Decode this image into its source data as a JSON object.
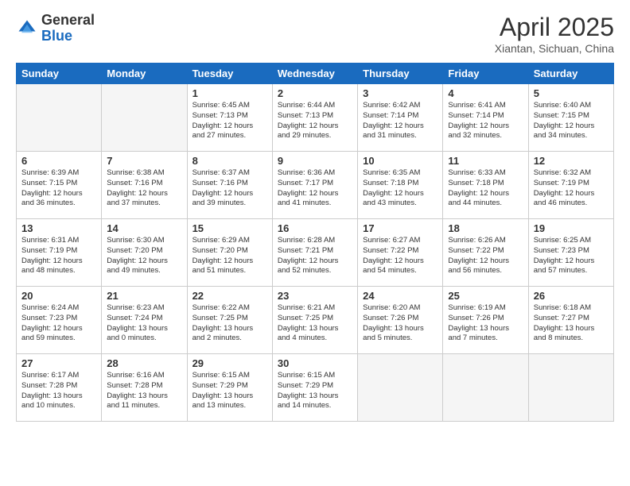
{
  "logo": {
    "general": "General",
    "blue": "Blue"
  },
  "title": "April 2025",
  "subtitle": "Xiantan, Sichuan, China",
  "days_of_week": [
    "Sunday",
    "Monday",
    "Tuesday",
    "Wednesday",
    "Thursday",
    "Friday",
    "Saturday"
  ],
  "weeks": [
    [
      {
        "day": "",
        "info": ""
      },
      {
        "day": "",
        "info": ""
      },
      {
        "day": "1",
        "info": "Sunrise: 6:45 AM\nSunset: 7:13 PM\nDaylight: 12 hours and 27 minutes."
      },
      {
        "day": "2",
        "info": "Sunrise: 6:44 AM\nSunset: 7:13 PM\nDaylight: 12 hours and 29 minutes."
      },
      {
        "day": "3",
        "info": "Sunrise: 6:42 AM\nSunset: 7:14 PM\nDaylight: 12 hours and 31 minutes."
      },
      {
        "day": "4",
        "info": "Sunrise: 6:41 AM\nSunset: 7:14 PM\nDaylight: 12 hours and 32 minutes."
      },
      {
        "day": "5",
        "info": "Sunrise: 6:40 AM\nSunset: 7:15 PM\nDaylight: 12 hours and 34 minutes."
      }
    ],
    [
      {
        "day": "6",
        "info": "Sunrise: 6:39 AM\nSunset: 7:15 PM\nDaylight: 12 hours and 36 minutes."
      },
      {
        "day": "7",
        "info": "Sunrise: 6:38 AM\nSunset: 7:16 PM\nDaylight: 12 hours and 37 minutes."
      },
      {
        "day": "8",
        "info": "Sunrise: 6:37 AM\nSunset: 7:16 PM\nDaylight: 12 hours and 39 minutes."
      },
      {
        "day": "9",
        "info": "Sunrise: 6:36 AM\nSunset: 7:17 PM\nDaylight: 12 hours and 41 minutes."
      },
      {
        "day": "10",
        "info": "Sunrise: 6:35 AM\nSunset: 7:18 PM\nDaylight: 12 hours and 43 minutes."
      },
      {
        "day": "11",
        "info": "Sunrise: 6:33 AM\nSunset: 7:18 PM\nDaylight: 12 hours and 44 minutes."
      },
      {
        "day": "12",
        "info": "Sunrise: 6:32 AM\nSunset: 7:19 PM\nDaylight: 12 hours and 46 minutes."
      }
    ],
    [
      {
        "day": "13",
        "info": "Sunrise: 6:31 AM\nSunset: 7:19 PM\nDaylight: 12 hours and 48 minutes."
      },
      {
        "day": "14",
        "info": "Sunrise: 6:30 AM\nSunset: 7:20 PM\nDaylight: 12 hours and 49 minutes."
      },
      {
        "day": "15",
        "info": "Sunrise: 6:29 AM\nSunset: 7:20 PM\nDaylight: 12 hours and 51 minutes."
      },
      {
        "day": "16",
        "info": "Sunrise: 6:28 AM\nSunset: 7:21 PM\nDaylight: 12 hours and 52 minutes."
      },
      {
        "day": "17",
        "info": "Sunrise: 6:27 AM\nSunset: 7:22 PM\nDaylight: 12 hours and 54 minutes."
      },
      {
        "day": "18",
        "info": "Sunrise: 6:26 AM\nSunset: 7:22 PM\nDaylight: 12 hours and 56 minutes."
      },
      {
        "day": "19",
        "info": "Sunrise: 6:25 AM\nSunset: 7:23 PM\nDaylight: 12 hours and 57 minutes."
      }
    ],
    [
      {
        "day": "20",
        "info": "Sunrise: 6:24 AM\nSunset: 7:23 PM\nDaylight: 12 hours and 59 minutes."
      },
      {
        "day": "21",
        "info": "Sunrise: 6:23 AM\nSunset: 7:24 PM\nDaylight: 13 hours and 0 minutes."
      },
      {
        "day": "22",
        "info": "Sunrise: 6:22 AM\nSunset: 7:25 PM\nDaylight: 13 hours and 2 minutes."
      },
      {
        "day": "23",
        "info": "Sunrise: 6:21 AM\nSunset: 7:25 PM\nDaylight: 13 hours and 4 minutes."
      },
      {
        "day": "24",
        "info": "Sunrise: 6:20 AM\nSunset: 7:26 PM\nDaylight: 13 hours and 5 minutes."
      },
      {
        "day": "25",
        "info": "Sunrise: 6:19 AM\nSunset: 7:26 PM\nDaylight: 13 hours and 7 minutes."
      },
      {
        "day": "26",
        "info": "Sunrise: 6:18 AM\nSunset: 7:27 PM\nDaylight: 13 hours and 8 minutes."
      }
    ],
    [
      {
        "day": "27",
        "info": "Sunrise: 6:17 AM\nSunset: 7:28 PM\nDaylight: 13 hours and 10 minutes."
      },
      {
        "day": "28",
        "info": "Sunrise: 6:16 AM\nSunset: 7:28 PM\nDaylight: 13 hours and 11 minutes."
      },
      {
        "day": "29",
        "info": "Sunrise: 6:15 AM\nSunset: 7:29 PM\nDaylight: 13 hours and 13 minutes."
      },
      {
        "day": "30",
        "info": "Sunrise: 6:15 AM\nSunset: 7:29 PM\nDaylight: 13 hours and 14 minutes."
      },
      {
        "day": "",
        "info": ""
      },
      {
        "day": "",
        "info": ""
      },
      {
        "day": "",
        "info": ""
      }
    ]
  ]
}
